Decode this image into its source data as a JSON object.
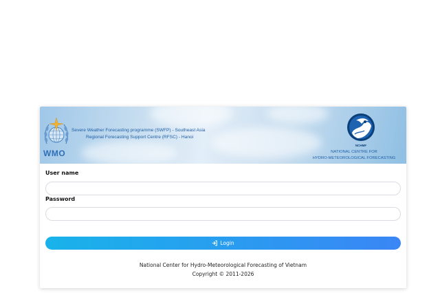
{
  "banner": {
    "wmo_label": "WMO",
    "programme_line1": "Severe Weather Forecasting programme (SWFP) - Southeast Asia",
    "programme_line2": "Regional Forecasting Support Centre (RFSC) - Hanoi",
    "nchmf_abbr": "NCHMF",
    "nchmf_name_line1": "NATIONAL CENTRE FOR",
    "nchmf_name_line2": "HYDRO-METEOROLOGICAL FORECASTING"
  },
  "form": {
    "username_label": "User name",
    "username_value": "",
    "password_label": "Password",
    "password_value": "",
    "login_label": "Login",
    "login_icon": "login-arrow-icon"
  },
  "footer": {
    "organization": "National Center for Hydro-Meteorological Forecasting of Vietnam",
    "copyright": "Copyright © 2011-2026"
  },
  "colors": {
    "login_button_start": "#19b3ea",
    "login_button_end": "#3a86f5",
    "banner_text": "#1f5fa8"
  }
}
